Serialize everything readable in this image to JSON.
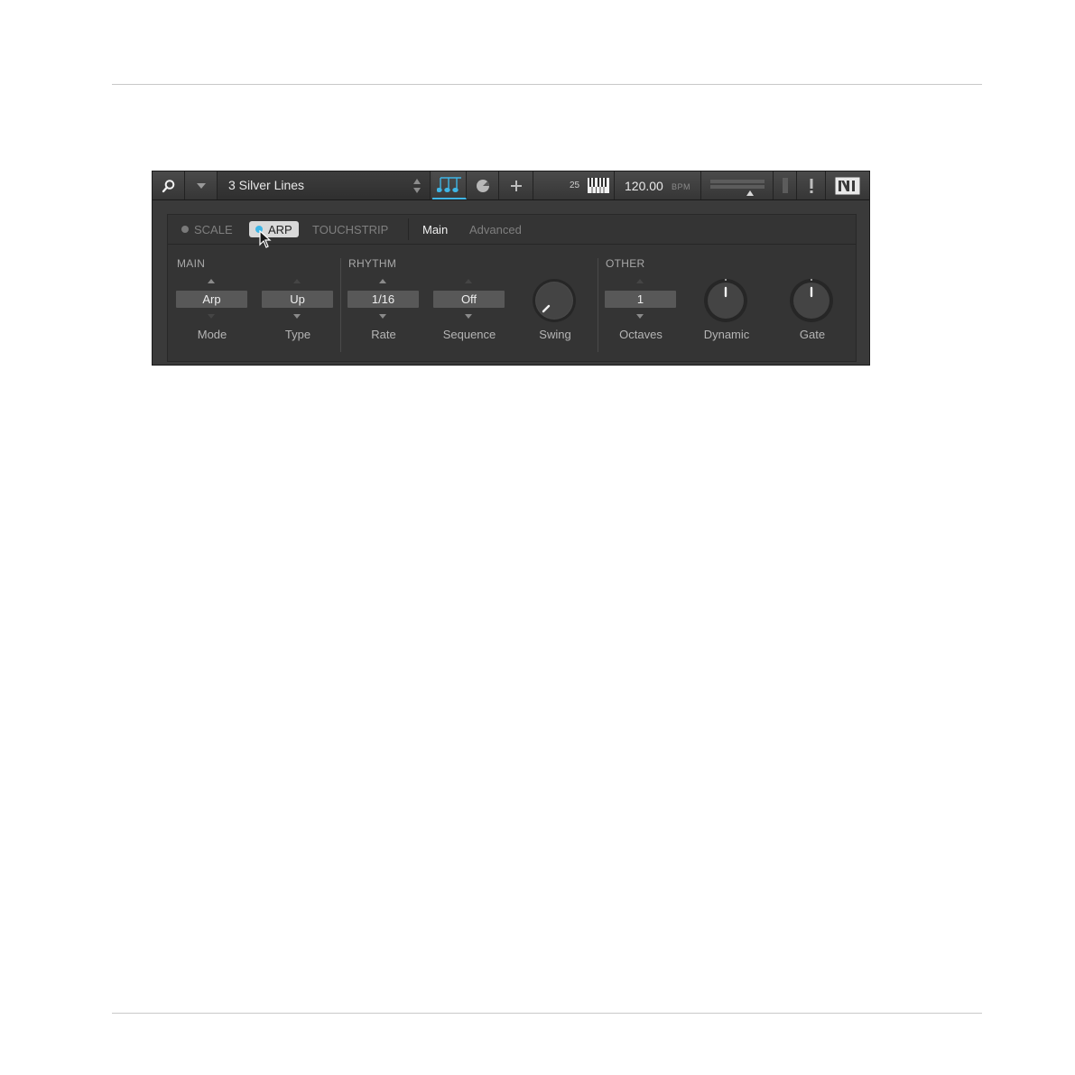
{
  "toolbar": {
    "preset_name": "3 Silver Lines",
    "keyboard_octave": "25",
    "tempo_value": "120.00",
    "tempo_unit": "BPM",
    "icons": [
      "search-icon",
      "dropdown-icon",
      "notes-icon",
      "circle-icon",
      "plus-icon",
      "keyboard-icon",
      "level-meter",
      "warning-icon",
      "ni-logo"
    ]
  },
  "tabs": {
    "scale": "SCALE",
    "arp": "ARP",
    "touchstrip": "TOUCHSTRIP",
    "main": "Main",
    "advanced": "Advanced"
  },
  "sections": {
    "main": "MAIN",
    "rhythm": "RHYTHM",
    "other": "OTHER"
  },
  "params": {
    "mode": {
      "label": "Mode",
      "value": "Arp"
    },
    "type": {
      "label": "Type",
      "value": "Up"
    },
    "rate": {
      "label": "Rate",
      "value": "1/16"
    },
    "sequence": {
      "label": "Sequence",
      "value": "Off"
    },
    "swing": {
      "label": "Swing"
    },
    "octaves": {
      "label": "Octaves",
      "value": "1"
    },
    "dynamic": {
      "label": "Dynamic"
    },
    "gate": {
      "label": "Gate"
    }
  },
  "colors": {
    "accent": "#3fb6e6",
    "panel_bg": "#343434",
    "header_bg": "#3f3f3f"
  }
}
